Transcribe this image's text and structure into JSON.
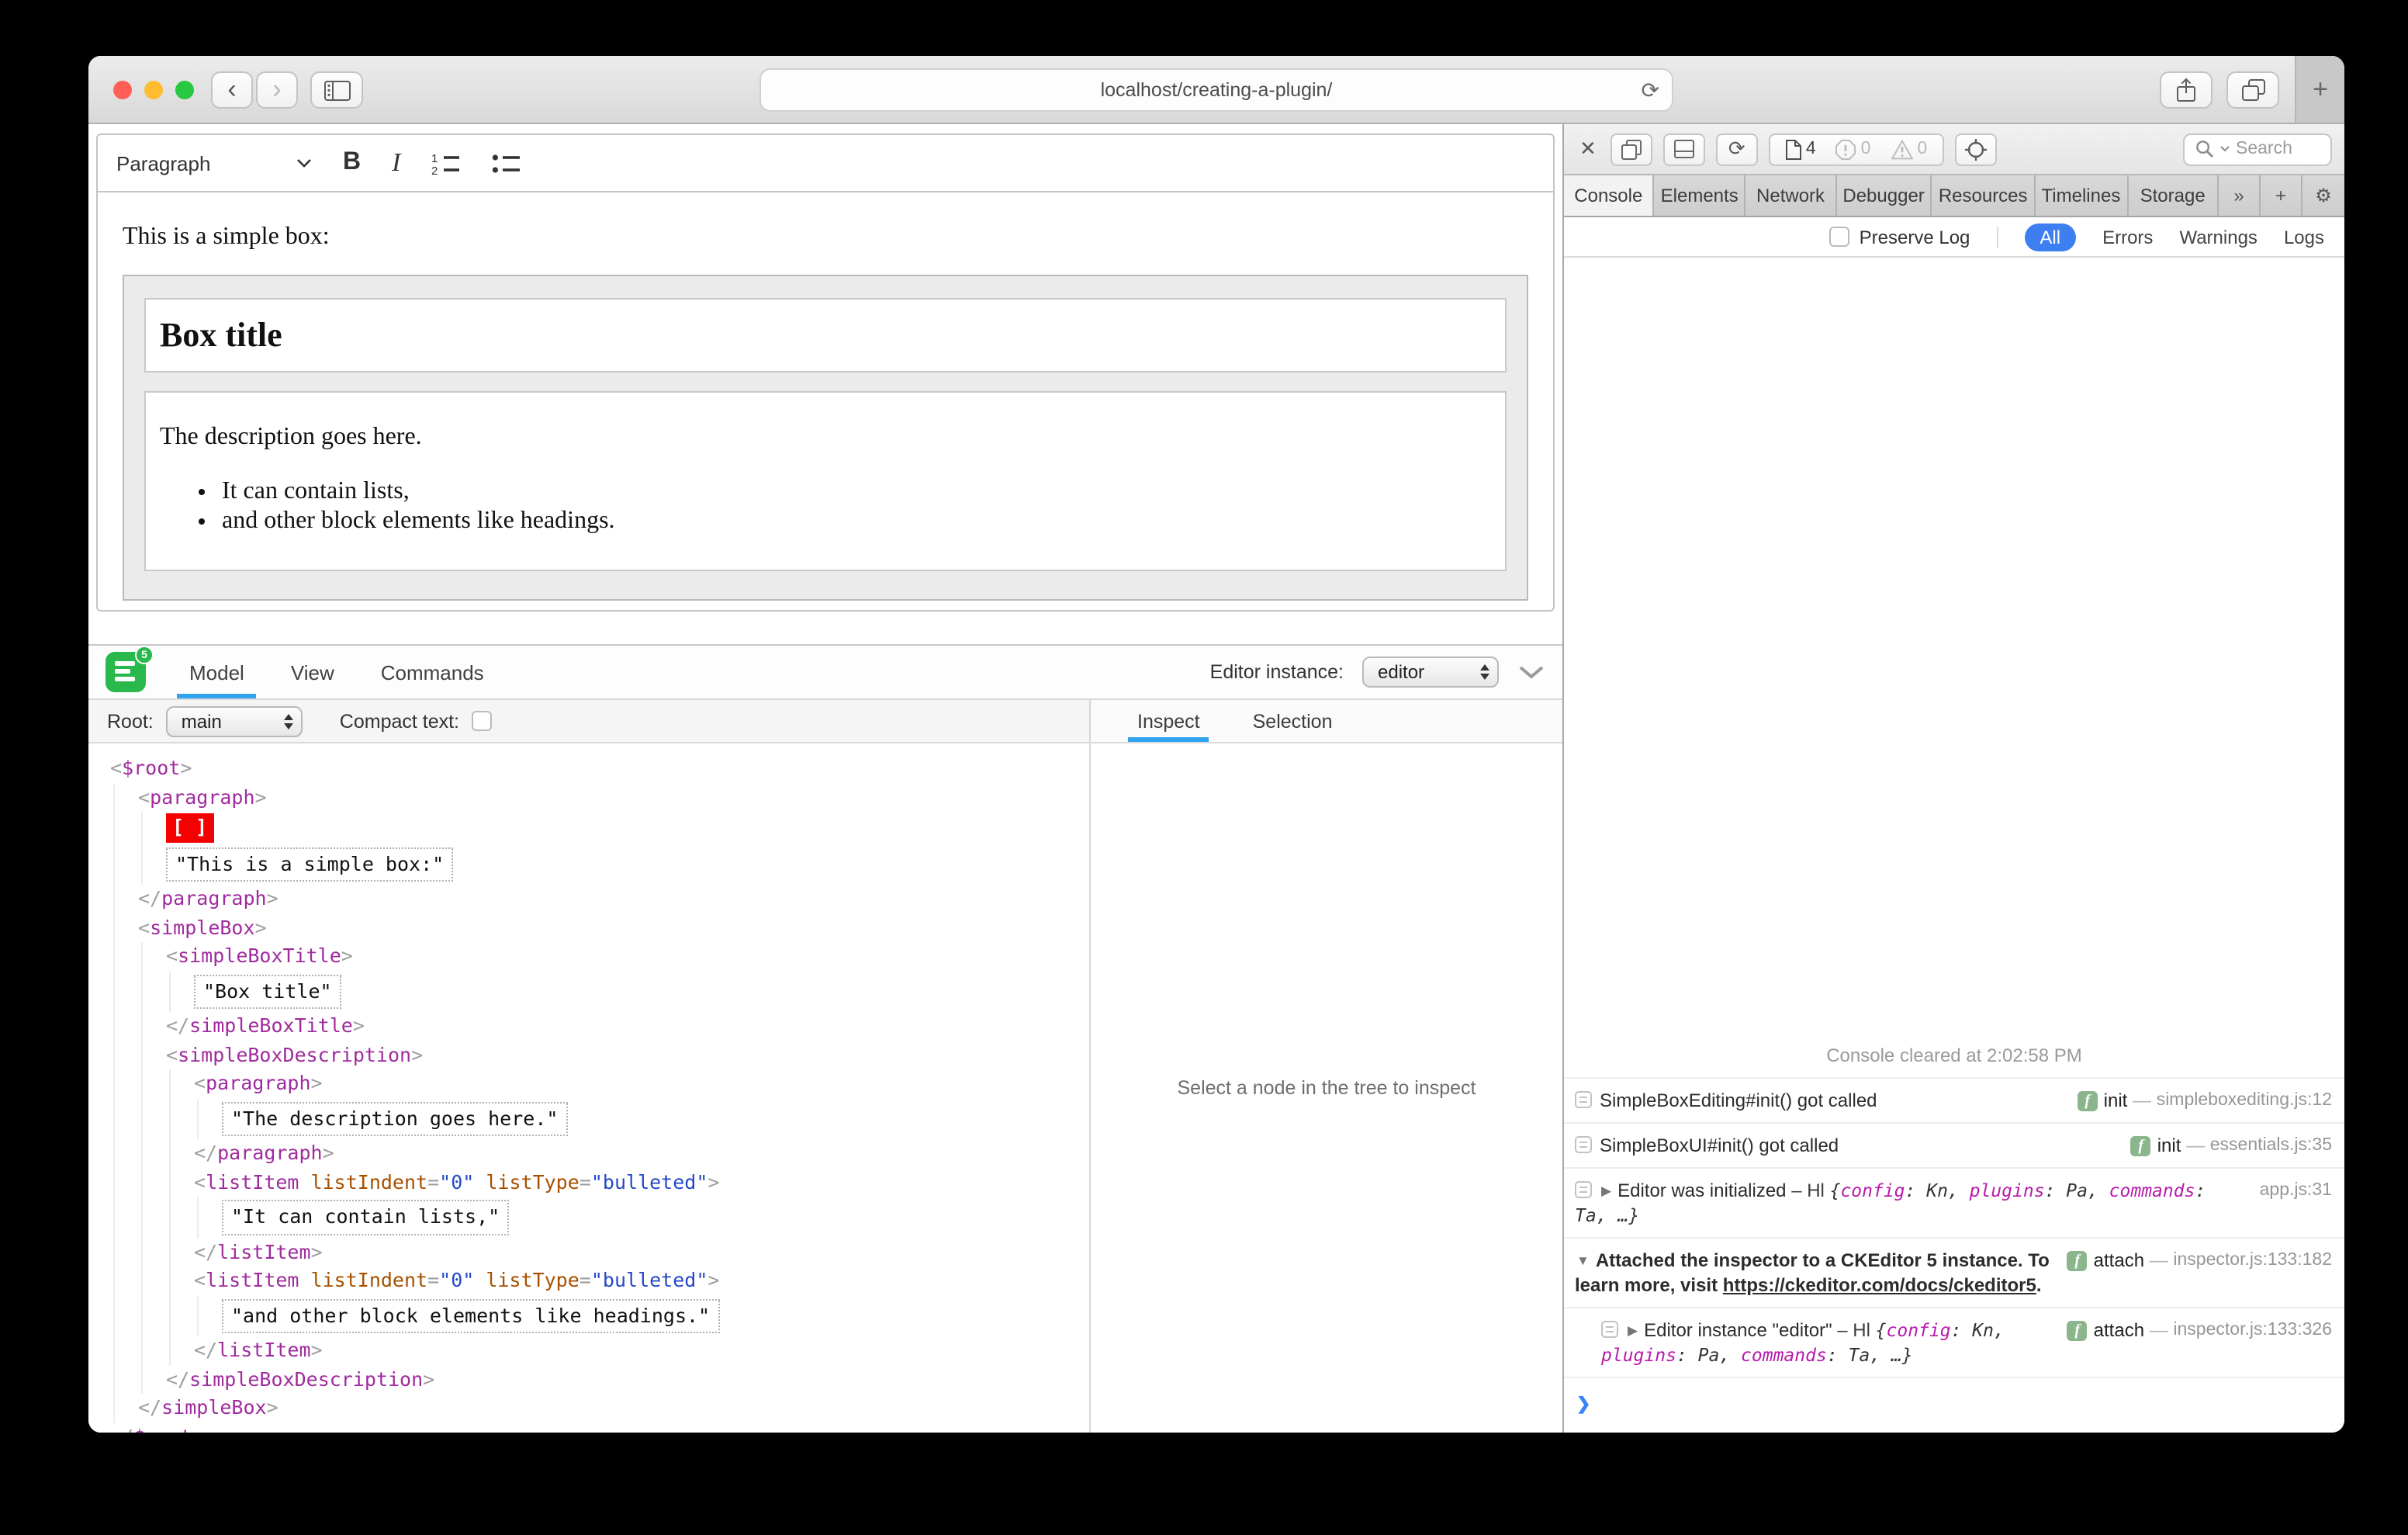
{
  "icons": {
    "back": "‹",
    "forward": "›",
    "plus": "+",
    "reload": "⟳",
    "close": "✕",
    "overflow": "»",
    "gear": "⚙",
    "prompt": "❯"
  },
  "browser": {
    "url": "localhost/creating-a-plugin/"
  },
  "editor": {
    "toolbar": {
      "paragraph_label": "Paragraph",
      "bold": "B",
      "italic": "I"
    },
    "content": {
      "intro": "This is a simple box:",
      "box_title": "Box title",
      "description": "The description goes here.",
      "bullets": [
        "It can contain lists,",
        "and other block elements like headings."
      ]
    }
  },
  "inspector": {
    "tabs": [
      "Model",
      "View",
      "Commands"
    ],
    "active_tab": "Model",
    "editor_instance_label": "Editor instance:",
    "editor_instance_value": "editor",
    "root_label": "Root:",
    "root_value": "main",
    "compact_label": "Compact text:",
    "side_tabs": [
      "Inspect",
      "Selection"
    ],
    "active_side_tab": "Inspect",
    "empty_message": "Select a node in the tree to inspect",
    "tree": [
      {
        "i": 0,
        "kind": "tag",
        "parts": [
          [
            "brk",
            "<"
          ],
          [
            "tag",
            "$root"
          ],
          [
            "brk",
            ">"
          ]
        ]
      },
      {
        "i": 1,
        "kind": "tag",
        "parts": [
          [
            "brk",
            "<"
          ],
          [
            "tag",
            "paragraph"
          ],
          [
            "brk",
            ">"
          ]
        ]
      },
      {
        "i": 2,
        "kind": "marker",
        "s": "[ ]"
      },
      {
        "i": 2,
        "kind": "text",
        "s": "\"This is a simple box:\""
      },
      {
        "i": 1,
        "kind": "tag",
        "parts": [
          [
            "brk",
            "</"
          ],
          [
            "tag",
            "paragraph"
          ],
          [
            "brk",
            ">"
          ]
        ]
      },
      {
        "i": 1,
        "kind": "tag",
        "parts": [
          [
            "brk",
            "<"
          ],
          [
            "tag",
            "simpleBox"
          ],
          [
            "brk",
            ">"
          ]
        ]
      },
      {
        "i": 2,
        "kind": "tag",
        "parts": [
          [
            "brk",
            "<"
          ],
          [
            "tag",
            "simpleBoxTitle"
          ],
          [
            "brk",
            ">"
          ]
        ]
      },
      {
        "i": 3,
        "kind": "text",
        "s": "\"Box title\""
      },
      {
        "i": 2,
        "kind": "tag",
        "parts": [
          [
            "brk",
            "</"
          ],
          [
            "tag",
            "simpleBoxTitle"
          ],
          [
            "brk",
            ">"
          ]
        ]
      },
      {
        "i": 2,
        "kind": "tag",
        "parts": [
          [
            "brk",
            "<"
          ],
          [
            "tag",
            "simpleBoxDescription"
          ],
          [
            "brk",
            ">"
          ]
        ]
      },
      {
        "i": 3,
        "kind": "tag",
        "parts": [
          [
            "brk",
            "<"
          ],
          [
            "tag",
            "paragraph"
          ],
          [
            "brk",
            ">"
          ]
        ]
      },
      {
        "i": 4,
        "kind": "text",
        "s": "\"The description goes here.\""
      },
      {
        "i": 3,
        "kind": "tag",
        "parts": [
          [
            "brk",
            "</"
          ],
          [
            "tag",
            "paragraph"
          ],
          [
            "brk",
            ">"
          ]
        ]
      },
      {
        "i": 3,
        "kind": "tag",
        "parts": [
          [
            "brk",
            "<"
          ],
          [
            "tag",
            "listItem"
          ],
          [
            "pln",
            " "
          ],
          [
            "attr",
            "listIndent"
          ],
          [
            "brk",
            "="
          ],
          [
            "val",
            "\"0\""
          ],
          [
            "pln",
            " "
          ],
          [
            "attr",
            "listType"
          ],
          [
            "brk",
            "="
          ],
          [
            "val",
            "\"bulleted\""
          ],
          [
            "brk",
            ">"
          ]
        ]
      },
      {
        "i": 4,
        "kind": "text",
        "s": "\"It can contain lists,\""
      },
      {
        "i": 3,
        "kind": "tag",
        "parts": [
          [
            "brk",
            "</"
          ],
          [
            "tag",
            "listItem"
          ],
          [
            "brk",
            ">"
          ]
        ]
      },
      {
        "i": 3,
        "kind": "tag",
        "parts": [
          [
            "brk",
            "<"
          ],
          [
            "tag",
            "listItem"
          ],
          [
            "pln",
            " "
          ],
          [
            "attr",
            "listIndent"
          ],
          [
            "brk",
            "="
          ],
          [
            "val",
            "\"0\""
          ],
          [
            "pln",
            " "
          ],
          [
            "attr",
            "listType"
          ],
          [
            "brk",
            "="
          ],
          [
            "val",
            "\"bulleted\""
          ],
          [
            "brk",
            ">"
          ]
        ]
      },
      {
        "i": 4,
        "kind": "text",
        "s": "\"and other block elements like headings.\""
      },
      {
        "i": 3,
        "kind": "tag",
        "parts": [
          [
            "brk",
            "</"
          ],
          [
            "tag",
            "listItem"
          ],
          [
            "brk",
            ">"
          ]
        ]
      },
      {
        "i": 2,
        "kind": "tag",
        "parts": [
          [
            "brk",
            "</"
          ],
          [
            "tag",
            "simpleBoxDescription"
          ],
          [
            "brk",
            ">"
          ]
        ]
      },
      {
        "i": 1,
        "kind": "tag",
        "parts": [
          [
            "brk",
            "</"
          ],
          [
            "tag",
            "simpleBox"
          ],
          [
            "brk",
            ">"
          ]
        ]
      },
      {
        "i": 0,
        "kind": "tag",
        "parts": [
          [
            "brk",
            "</"
          ],
          [
            "tag",
            "$root"
          ],
          [
            "brk",
            ">"
          ]
        ]
      }
    ]
  },
  "devtools": {
    "toolbar": {
      "page_count": "4",
      "error_count": "0",
      "warning_count": "0",
      "search_placeholder": "Search"
    },
    "tabs": [
      "Console",
      "Elements",
      "Network",
      "Debugger",
      "Resources",
      "Timelines",
      "Storage"
    ],
    "active_tab": "Console",
    "filter": {
      "preserve_label": "Preserve Log",
      "scopes": [
        "All",
        "Errors",
        "Warnings",
        "Logs"
      ],
      "active_scope": "All"
    },
    "console": {
      "cleared": "Console cleared at 2:02:58 PM",
      "fn_badge": "f",
      "meta_dash": " — ",
      "rows": [
        {
          "icon": true,
          "text": [
            {
              "s": "SimpleBoxEditing#init() got called"
            }
          ],
          "fn": "init",
          "loc": "simpleboxediting.js:12"
        },
        {
          "icon": true,
          "text": [
            {
              "s": "SimpleBoxUI#init() got called"
            }
          ],
          "fn": "init",
          "loc": "essentials.js:35"
        },
        {
          "icon": true,
          "arrow": "▶",
          "text": [
            {
              "s": "Editor was initialized"
            },
            {
              "s": " – Hl ",
              "c": "dim"
            },
            {
              "s": "{",
              "c": "obj"
            },
            {
              "s": "config",
              "c": "key"
            },
            {
              "s": ": Kn, ",
              "c": "obj"
            },
            {
              "s": "plugins",
              "c": "key"
            },
            {
              "s": ": Pa, ",
              "c": "obj"
            },
            {
              "s": "commands",
              "c": "key"
            },
            {
              "s": ": Ta",
              "c": "obj"
            },
            {
              "s": ", …}",
              "c": "obj"
            }
          ],
          "loc": "app.js:31"
        },
        {
          "arrow": "▼",
          "text": [
            {
              "s": "Attached the inspector to a CKEditor 5 instance. To learn more, visit ",
              "c": "bold"
            },
            {
              "s": "https://ckeditor.com/docs/ckeditor5",
              "c": "link"
            },
            {
              "s": ".",
              "c": "bold"
            }
          ],
          "fn": "attach",
          "loc": "inspector.js:133:182"
        },
        {
          "icon": true,
          "indent": true,
          "arrow": "▶",
          "text": [
            {
              "s": "Editor instance \"editor\""
            },
            {
              "s": " – Hl ",
              "c": "dim"
            },
            {
              "s": "{",
              "c": "obj"
            },
            {
              "s": "config",
              "c": "key"
            },
            {
              "s": ": Kn, ",
              "c": "obj"
            },
            {
              "s": "plugins",
              "c": "key"
            },
            {
              "s": ": Pa, ",
              "c": "obj"
            },
            {
              "s": "commands",
              "c": "key"
            },
            {
              "s": ": Ta, …}",
              "c": "obj"
            }
          ],
          "fn": "attach",
          "loc": "inspector.js:133:326"
        }
      ]
    }
  }
}
